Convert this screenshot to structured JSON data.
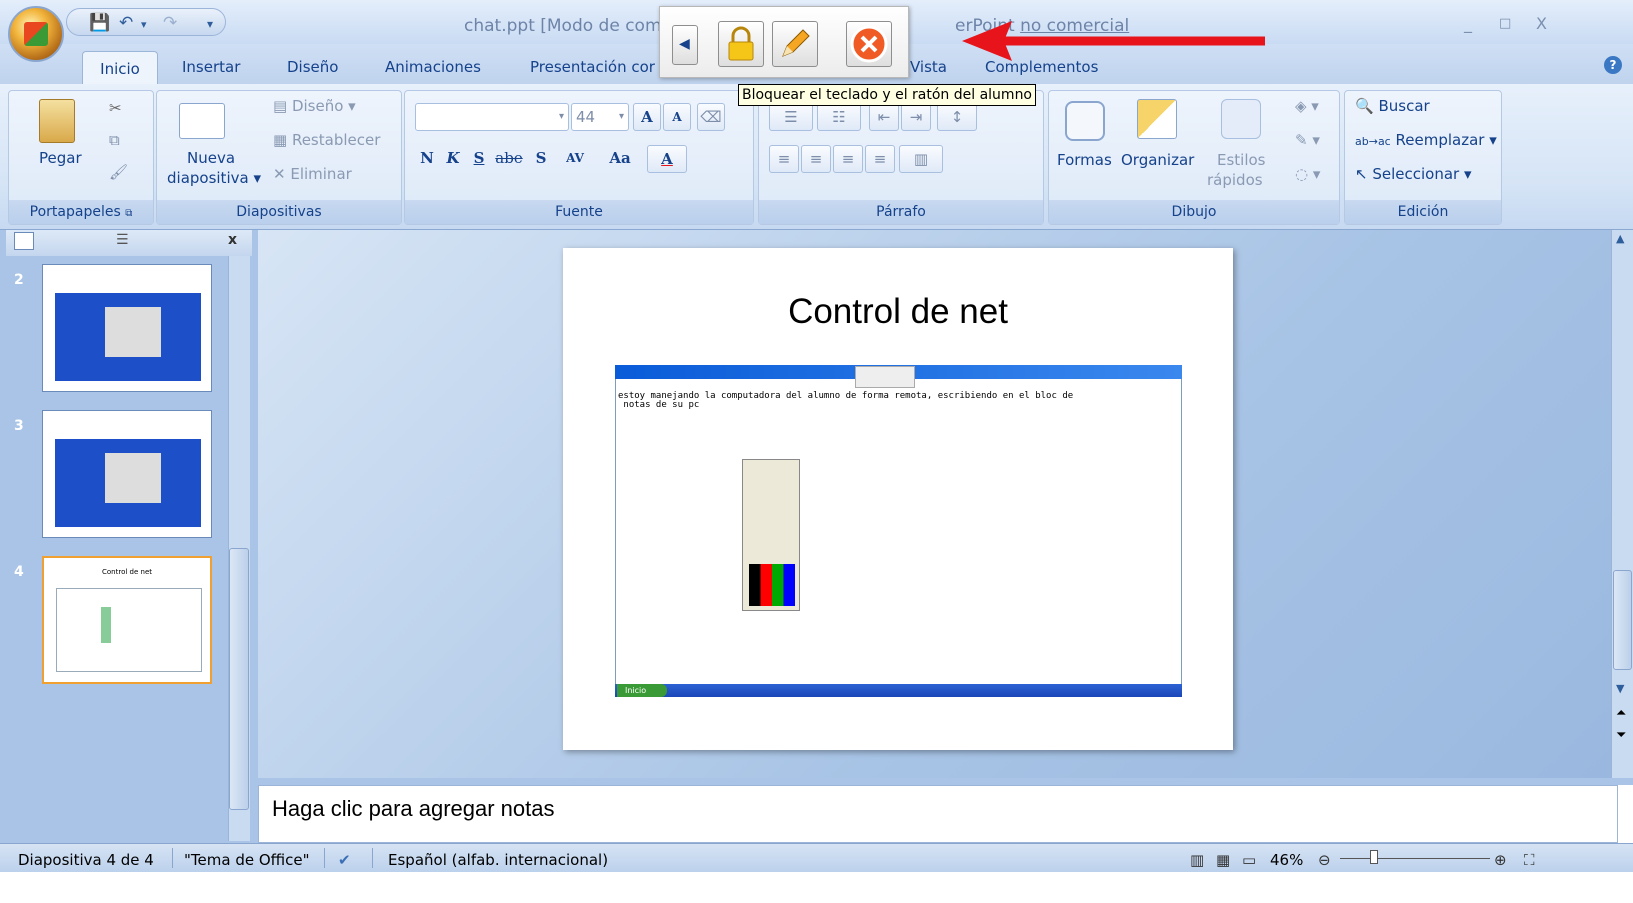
{
  "window": {
    "title_start": "chat.ppt [Modo de com",
    "title_end": "erPoint",
    "title_hidden_tail": "no comercial",
    "controls": [
      "_",
      "□",
      "X"
    ]
  },
  "tabs": {
    "inicio": "Inicio",
    "insertar": "Insertar",
    "diseno": "Diseño",
    "animaciones": "Animaciones",
    "presentacion": "Presentación cor",
    "vista": "Vista",
    "complementos": "Complementos"
  },
  "ribbon": {
    "portapapeles": {
      "title": "Portapapeles",
      "pegar": "Pegar"
    },
    "diapositivas": {
      "title": "Diapositivas",
      "nueva_line1": "Nueva",
      "nueva_line2": "diapositiva",
      "diseno": "Diseño",
      "restablecer": "Restablecer",
      "eliminar": "Eliminar"
    },
    "fuente": {
      "title": "Fuente",
      "size": "44",
      "bold": "N",
      "italic": "K",
      "underline": "S",
      "strike": "abe",
      "shadow": "S",
      "spacing": "AV",
      "case": "Aa",
      "color": "A"
    },
    "parrafo": {
      "title": "Párrafo"
    },
    "dibujo": {
      "title": "Dibujo",
      "formas": "Formas",
      "organizar": "Organizar",
      "estilos_line1": "Estilos",
      "estilos_line2": "rápidos"
    },
    "edicion": {
      "title": "Edición",
      "buscar": "Buscar",
      "reemplazar": "Reemplazar",
      "seleccionar": "Seleccionar"
    }
  },
  "remote_toolbar": {
    "tooltip": "Bloquear el teclado y el ratón del alumno"
  },
  "thumbnails": [
    {
      "number": "2",
      "caption": ""
    },
    {
      "number": "3",
      "caption": ""
    },
    {
      "number": "4",
      "caption": "Control de net"
    }
  ],
  "panel": {
    "close": "x"
  },
  "slide": {
    "title": "Control de net",
    "notepad_text": "estoy manejando la computadora del alumno de forma remota, escribiendo en el bloc de\n notas de su pc",
    "taskbar_start": "Inicio"
  },
  "notes": {
    "placeholder": "Haga clic para agregar notas"
  },
  "status": {
    "slide": "Diapositiva 4 de 4",
    "theme": "\"Tema de Office\"",
    "language": "Español (alfab. internacional)",
    "zoom": "46%"
  },
  "colors": {
    "ribbon_text": "#15428b",
    "arrow": "#e8141b",
    "tooltip_bg": "#ffffe1"
  }
}
